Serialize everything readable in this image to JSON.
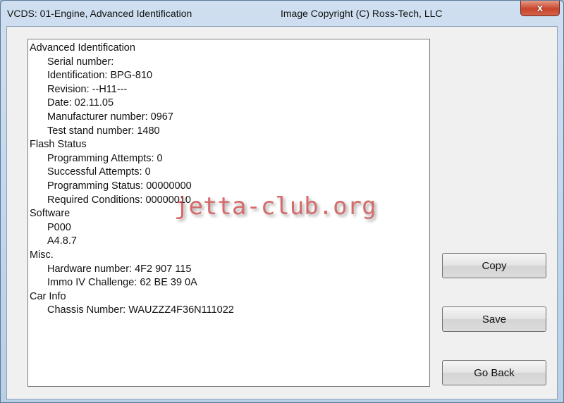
{
  "window": {
    "title": "VCDS: 01-Engine,  Advanced Identification",
    "copyright": "Image Copyright (C) Ross-Tech, LLC",
    "close_glyph": "x"
  },
  "content": {
    "lines": [
      {
        "text": "Advanced Identification",
        "indent": false
      },
      {
        "text": "Serial number:",
        "indent": true
      },
      {
        "text": "Identification: BPG-810",
        "indent": true
      },
      {
        "text": "Revision: --H11---",
        "indent": true
      },
      {
        "text": "Date: 02.11.05",
        "indent": true
      },
      {
        "text": "Manufacturer number: 0967",
        "indent": true
      },
      {
        "text": "Test stand number: 1480",
        "indent": true
      },
      {
        "text": "Flash Status",
        "indent": false
      },
      {
        "text": "Programming Attempts: 0",
        "indent": true
      },
      {
        "text": "Successful Attempts: 0",
        "indent": true
      },
      {
        "text": "Programming Status: 00000000",
        "indent": true
      },
      {
        "text": "Required Conditions: 00000010",
        "indent": true
      },
      {
        "text": "Software",
        "indent": false
      },
      {
        "text": "P000",
        "indent": true
      },
      {
        "text": "A4.8.7",
        "indent": true
      },
      {
        "text": "Misc.",
        "indent": false
      },
      {
        "text": "Hardware number: 4F2 907 115",
        "indent": true
      },
      {
        "text": "Immo IV Challenge: 62 BE 39 0A",
        "indent": true
      },
      {
        "text": "Car Info",
        "indent": false
      },
      {
        "text": "Chassis Number: WAUZZZ4F36N111022",
        "indent": true
      }
    ]
  },
  "buttons": {
    "copy": "Copy",
    "save": "Save",
    "go_back": "Go Back"
  },
  "watermark": "jetta-club.org"
}
